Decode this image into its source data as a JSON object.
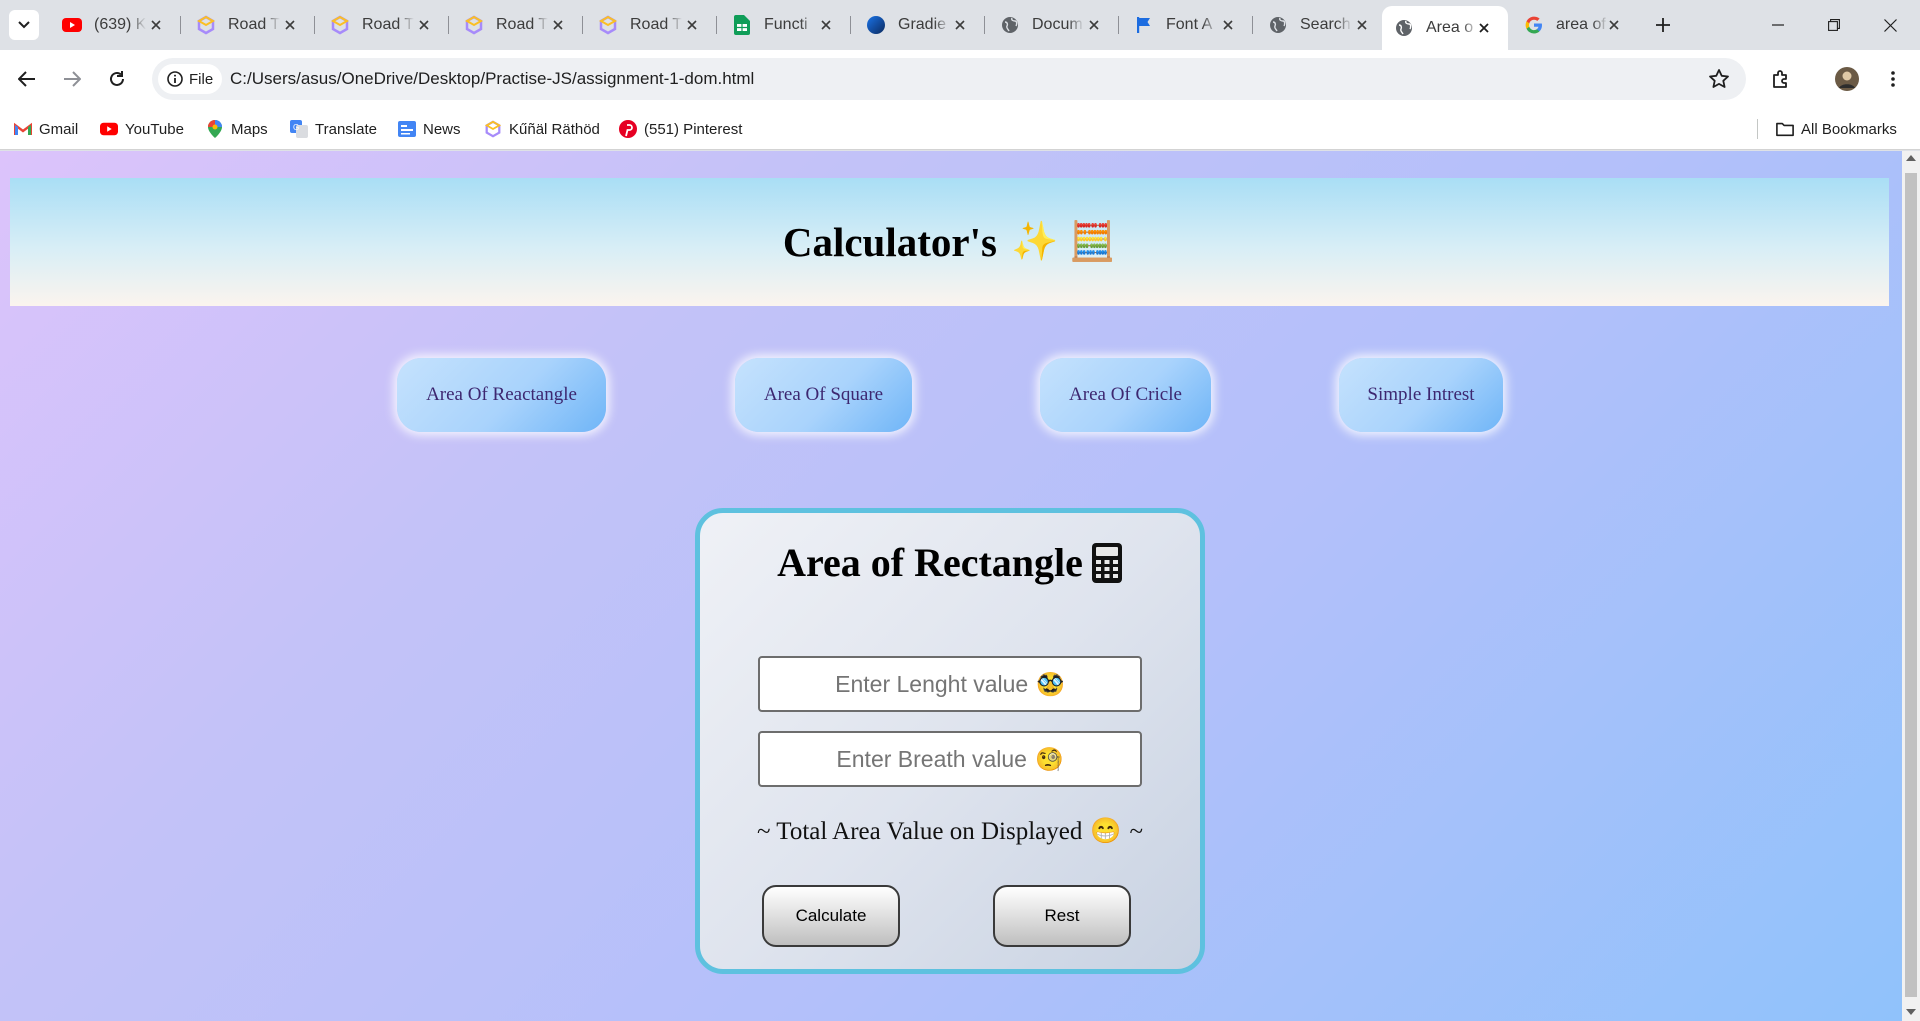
{
  "browser": {
    "tabs": [
      {
        "title": "(639) K",
        "icon": "youtube-icon"
      },
      {
        "title": "Road T",
        "icon": "roadmap-icon"
      },
      {
        "title": "Road T",
        "icon": "roadmap-icon"
      },
      {
        "title": "Road T",
        "icon": "roadmap-icon"
      },
      {
        "title": "Road T",
        "icon": "roadmap-icon"
      },
      {
        "title": "Functi",
        "icon": "sheets-icon"
      },
      {
        "title": "Gradie",
        "icon": "gradient-icon"
      },
      {
        "title": "Docum",
        "icon": "globe-icon"
      },
      {
        "title": "Font A",
        "icon": "flag-icon"
      },
      {
        "title": "Search",
        "icon": "globe-icon"
      },
      {
        "title": "Area o",
        "icon": "globe-icon"
      },
      {
        "title": "area of",
        "icon": "google-icon"
      }
    ],
    "active_tab_index": 10,
    "address": {
      "chip_label": "File",
      "url": "C:/Users/asus/OneDrive/Desktop/Practise-JS/assignment-1-dom.html"
    },
    "bookmarks": [
      {
        "label": "Gmail",
        "icon": "gmail-icon"
      },
      {
        "label": "YouTube",
        "icon": "youtube-icon"
      },
      {
        "label": "Maps",
        "icon": "maps-icon"
      },
      {
        "label": "Translate",
        "icon": "translate-icon"
      },
      {
        "label": "News",
        "icon": "news-icon"
      },
      {
        "label": "Kűñäl Räthöd",
        "icon": "roadmap-icon"
      },
      {
        "label": "(551) Pinterest",
        "icon": "pinterest-icon"
      }
    ],
    "all_bookmarks_label": "All Bookmarks"
  },
  "page": {
    "header": {
      "title": "Calculator's",
      "emojis": "✨ 🧮"
    },
    "nav": [
      {
        "label": "Area Of Reactangle"
      },
      {
        "label": "Area Of Square"
      },
      {
        "label": "Area Of Cricle"
      },
      {
        "label": "Simple Intrest"
      }
    ],
    "card": {
      "title": "Area of Rectangle",
      "title_emoji": "🖩",
      "length_placeholder": "Enter Lenght value",
      "length_emoji": "🥸",
      "breadth_placeholder": "Enter Breath value",
      "breadth_emoji": "🧐",
      "result_text": "~ Total Area Value on Displayed",
      "result_emoji": "😁",
      "result_tail": "~",
      "calculate_label": "Calculate",
      "reset_label": "Rest"
    }
  },
  "colors": {
    "card_border": "#5ec1df",
    "nav_text": "#3d2770",
    "page_gradient_start": "#dcc3fb",
    "page_gradient_end": "#90c2fb"
  }
}
